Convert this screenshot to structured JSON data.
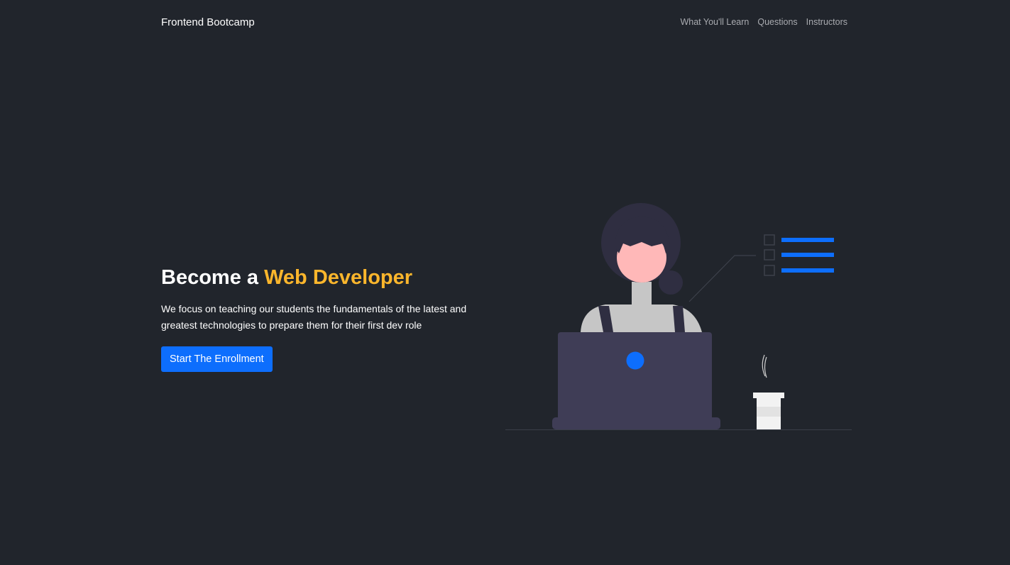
{
  "navbar": {
    "brand": "Frontend Bootcamp",
    "links": [
      {
        "label": "What You'll Learn"
      },
      {
        "label": "Questions"
      },
      {
        "label": "Instructors"
      }
    ]
  },
  "hero": {
    "title_prefix": "Become a ",
    "title_accent": "Web Developer",
    "description": "We focus on teaching our students the fundamentals of the latest and greatest technologies to prepare them for their first dev role",
    "cta_label": "Start The Enrollment"
  },
  "colors": {
    "background": "#21252c",
    "accent": "#fbb62c",
    "primary": "#0d6efd"
  },
  "illustration": {
    "icon": "developer-at-laptop-illustration"
  }
}
